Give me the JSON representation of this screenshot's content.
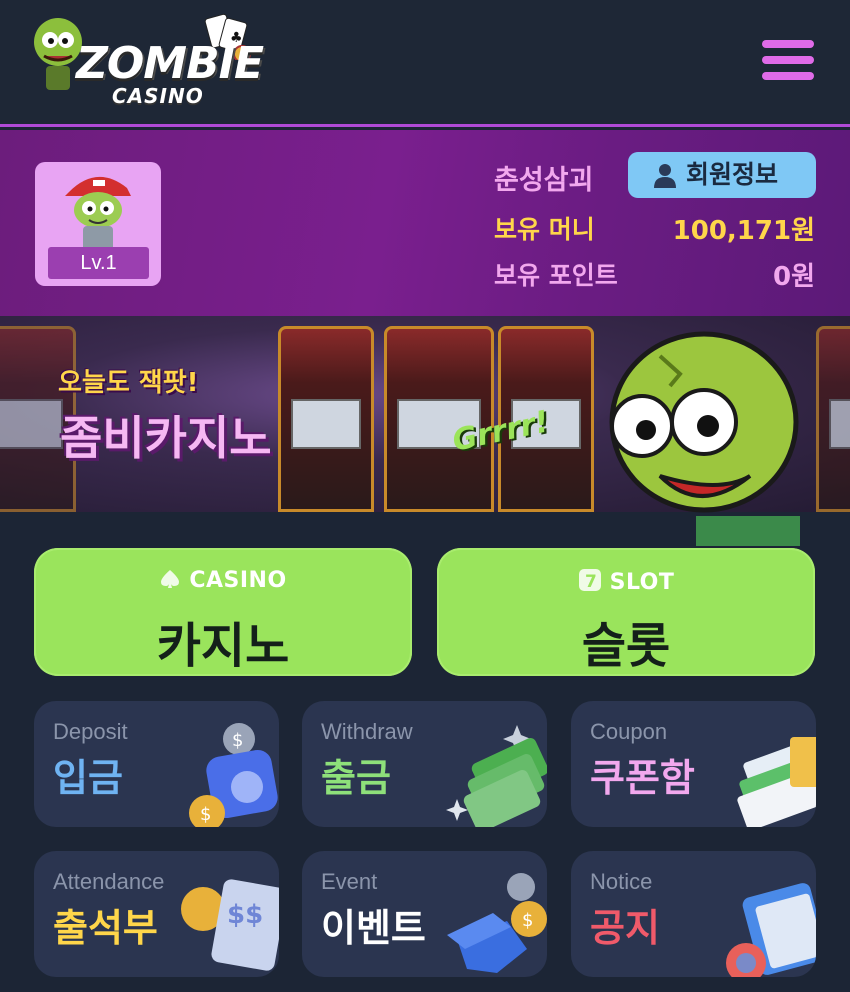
{
  "header": {
    "logo_main": "ZOMBIE",
    "logo_sub": "CASINO",
    "menu_icon": "hamburger-icon"
  },
  "profile": {
    "level": "Lv.1",
    "username": "춘성삼괴",
    "member_button": "회원정보",
    "money_label": "보유 머니",
    "money_value": "100,171원",
    "points_label": "보유 포인트",
    "points_value": "0원"
  },
  "banner": {
    "line1": "오늘도 잭팟!",
    "line2": "좀비카지노",
    "sticker": "Grrrr!"
  },
  "games": [
    {
      "en": "CASINO",
      "ko": "카지노",
      "icon": "spade-icon"
    },
    {
      "en": "SLOT",
      "ko": "슬롯",
      "icon": "seven-icon"
    }
  ],
  "tiles": [
    {
      "en": "Deposit",
      "ko": "입금",
      "color": "#6fb3f2",
      "icon": "wallet-icon"
    },
    {
      "en": "Withdraw",
      "ko": "출금",
      "color": "#8ee07a",
      "icon": "cash-icon"
    },
    {
      "en": "Coupon",
      "ko": "쿠폰함",
      "color": "#f2a8ee",
      "icon": "coupon-icon"
    },
    {
      "en": "Attendance",
      "ko": "출석부",
      "color": "#ffd64a",
      "icon": "calendar-icon"
    },
    {
      "en": "Event",
      "ko": "이벤트",
      "color": "#ffffff",
      "icon": "gift-box-icon"
    },
    {
      "en": "Notice",
      "ko": "공지",
      "color": "#f05a6a",
      "icon": "megaphone-icon"
    }
  ],
  "colors": {
    "accent_purple": "#b04ad6",
    "game_green": "#9ae45c",
    "money_yellow": "#ffd64a",
    "pink": "#f2a8ee"
  }
}
